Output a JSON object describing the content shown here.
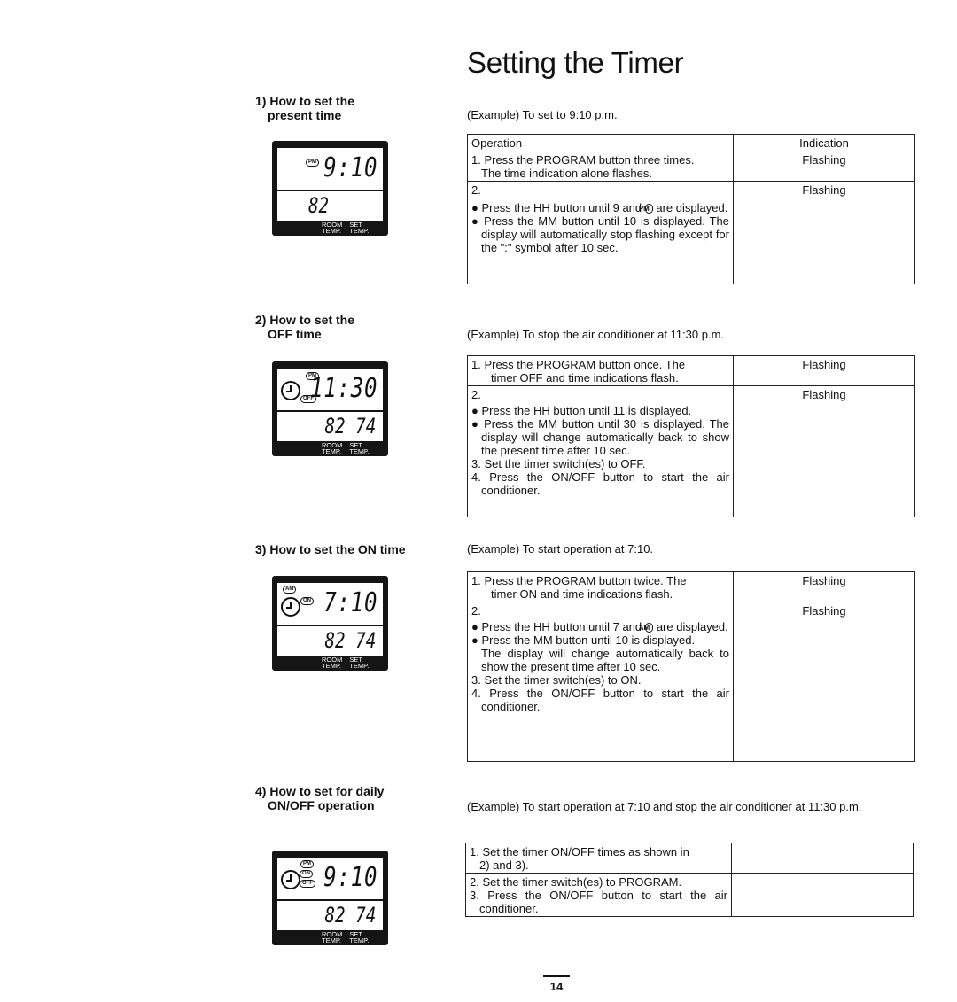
{
  "page": {
    "title": "Setting the Timer",
    "page_number": "14"
  },
  "sections": [
    {
      "heading_line1": "1) How to set the",
      "heading_line2": "present time",
      "example": "(Example) To set to 9:10 p.m.",
      "display": {
        "indicators": [
          "PM"
        ],
        "clock_icon": false,
        "time": "9:10",
        "room_temp": "82",
        "set_temp": "",
        "label_room": [
          "ROOM",
          "TEMP."
        ],
        "label_set": [
          "SET",
          "TEMP."
        ]
      },
      "table": {
        "header": {
          "operation": "Operation",
          "indication": "Indication"
        },
        "rows": [
          {
            "lines": [
              "1. Press the PROGRAM button three times.",
              "The time indication alone flashes."
            ],
            "indication": "Flashing"
          },
          {
            "step": "2.",
            "bullets": [
              {
                "before": "Press the HH button until 9 and ",
                "badge": "PM",
                "after": " are displayed."
              },
              {
                "text": "Press the MM button until 10 is displayed. The display will automatically stop flashing except for the \":\" symbol after 10 sec."
              }
            ],
            "indication": "Flashing"
          }
        ]
      }
    },
    {
      "heading_line1": "2) How to set the",
      "heading_line2": "OFF time",
      "example": "(Example) To stop the air conditioner at 11:30 p.m.",
      "display": {
        "indicators": [
          "PM",
          "OFF"
        ],
        "clock_icon": true,
        "time": "11:30",
        "room_temp": "82",
        "set_temp": "74",
        "label_room": [
          "ROOM",
          "TEMP."
        ],
        "label_set": [
          "SET",
          "TEMP."
        ]
      },
      "table": {
        "rows": [
          {
            "lines": [
              "1. Press the PROGRAM button once. The",
              "timer OFF and time indications flash."
            ],
            "indication": "Flashing"
          },
          {
            "step": "2.",
            "bullets": [
              {
                "text": "Press the HH button until 11 is displayed."
              },
              {
                "text": "Press the MM button until 30 is displayed. The display will change automatically back to show the present time after 10 sec."
              }
            ],
            "numbered": [
              "3. Set the timer switch(es) to OFF.",
              "4. Press the ON/OFF button to start the air conditioner."
            ],
            "indication": "Flashing"
          }
        ]
      }
    },
    {
      "heading_line1": "3) How to set the ON time",
      "heading_line2": "",
      "example": "(Example) To start operation at 7:10.",
      "display": {
        "indicators": [
          "AM",
          "ON"
        ],
        "clock_icon": true,
        "time": "7:10",
        "room_temp": "82",
        "set_temp": "74",
        "label_room": [
          "ROOM",
          "TEMP."
        ],
        "label_set": [
          "SET",
          "TEMP."
        ]
      },
      "table": {
        "rows": [
          {
            "lines": [
              "1. Press the PROGRAM button twice. The",
              "timer ON and time indications flash."
            ],
            "indication": "Flashing"
          },
          {
            "step": "2.",
            "bullets": [
              {
                "before": "Press the HH button until 7 and ",
                "badge": "AM",
                "after": " are displayed."
              },
              {
                "text": "Press the MM button until 10 is displayed."
              }
            ],
            "note": "The display will change automatically back to show the present time after 10 sec.",
            "numbered": [
              "3. Set the timer switch(es) to ON.",
              "4. Press the ON/OFF button to start the air conditioner."
            ],
            "indication": "Flashing"
          }
        ]
      }
    },
    {
      "heading_line1": "4) How to set for daily",
      "heading_line2": "ON/OFF operation",
      "example": "(Example) To start operation at 7:10 and stop the air conditioner at 11:30 p.m.",
      "display": {
        "indicators": [
          "PM",
          "ON",
          "OFF"
        ],
        "clock_icon": true,
        "time": "9:10",
        "room_temp": "82",
        "set_temp": "74",
        "label_room": [
          "ROOM",
          "TEMP."
        ],
        "label_set": [
          "SET",
          "TEMP."
        ]
      },
      "table": {
        "rows": [
          {
            "lines": [
              "1. Set the timer ON/OFF times as shown in",
              "2) and 3)."
            ],
            "indication": ""
          },
          {
            "numbered": [
              "2. Set the timer switch(es) to PROGRAM.",
              "3. Press the ON/OFF button to start the air conditioner."
            ],
            "indication": ""
          }
        ]
      }
    }
  ]
}
